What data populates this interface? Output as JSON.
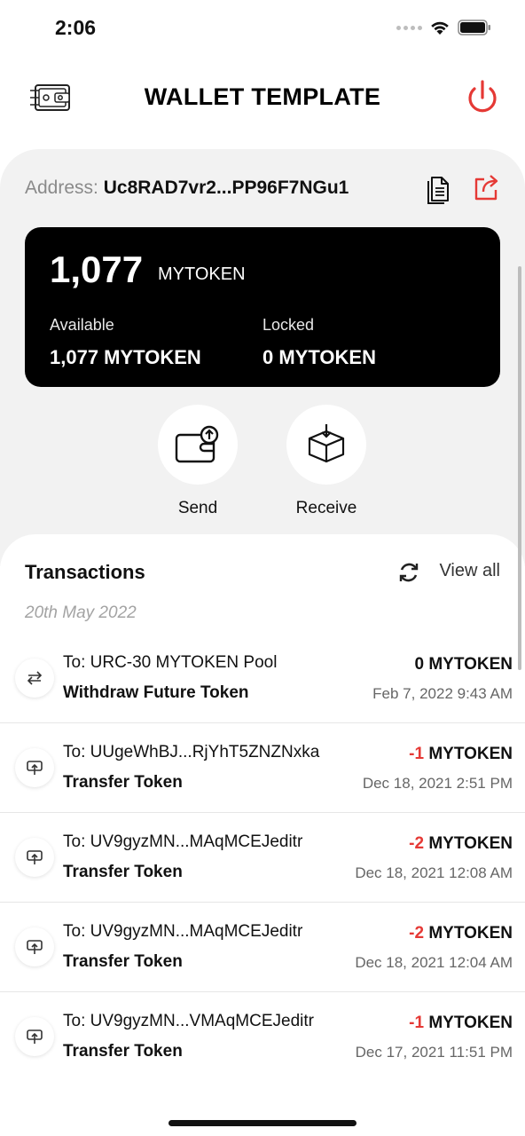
{
  "status": {
    "time": "2:06"
  },
  "header": {
    "title": "WALLET TEMPLATE"
  },
  "address": {
    "label": "Address:",
    "value": "Uc8RAD7vr2...PP96F7NGu1"
  },
  "balance": {
    "total": "1,077",
    "unit": "MYTOKEN",
    "available_label": "Available",
    "available_value": "1,077 MYTOKEN",
    "locked_label": "Locked",
    "locked_value": "0 MYTOKEN"
  },
  "actions": {
    "send": "Send",
    "receive": "Receive"
  },
  "transactions": {
    "title": "Transactions",
    "view_all": "View all",
    "date": "20th May 2022",
    "items": [
      {
        "to": "To: URC-30 MYTOKEN Pool",
        "type": "Withdraw Future Token",
        "amount_sign": "",
        "amount_value": "0 MYTOKEN",
        "time": "Feb 7, 2022 9:43 AM",
        "icon": "swap-icon"
      },
      {
        "to": "To: UUgeWhBJ...RjYhT5ZNZNxka",
        "type": "Transfer Token",
        "amount_sign": "-1",
        "amount_value": " MYTOKEN",
        "time": "Dec 18, 2021 2:51 PM",
        "icon": "transfer-icon"
      },
      {
        "to": "To: UV9gyzMN...MAqMCEJeditr",
        "type": "Transfer Token",
        "amount_sign": "-2",
        "amount_value": " MYTOKEN",
        "time": "Dec 18, 2021 12:08 AM",
        "icon": "transfer-icon"
      },
      {
        "to": "To: UV9gyzMN...MAqMCEJeditr",
        "type": "Transfer Token",
        "amount_sign": "-2",
        "amount_value": " MYTOKEN",
        "time": "Dec 18, 2021 12:04 AM",
        "icon": "transfer-icon"
      },
      {
        "to": "To: UV9gyzMN...VMAqMCEJeditr",
        "type": "Transfer Token",
        "amount_sign": "-1",
        "amount_value": " MYTOKEN",
        "time": "Dec 17, 2021 11:51 PM",
        "icon": "transfer-icon"
      }
    ]
  },
  "colors": {
    "accent_red": "#e53935",
    "card_bg": "#000000",
    "panel_bg": "#f2f2f2"
  }
}
